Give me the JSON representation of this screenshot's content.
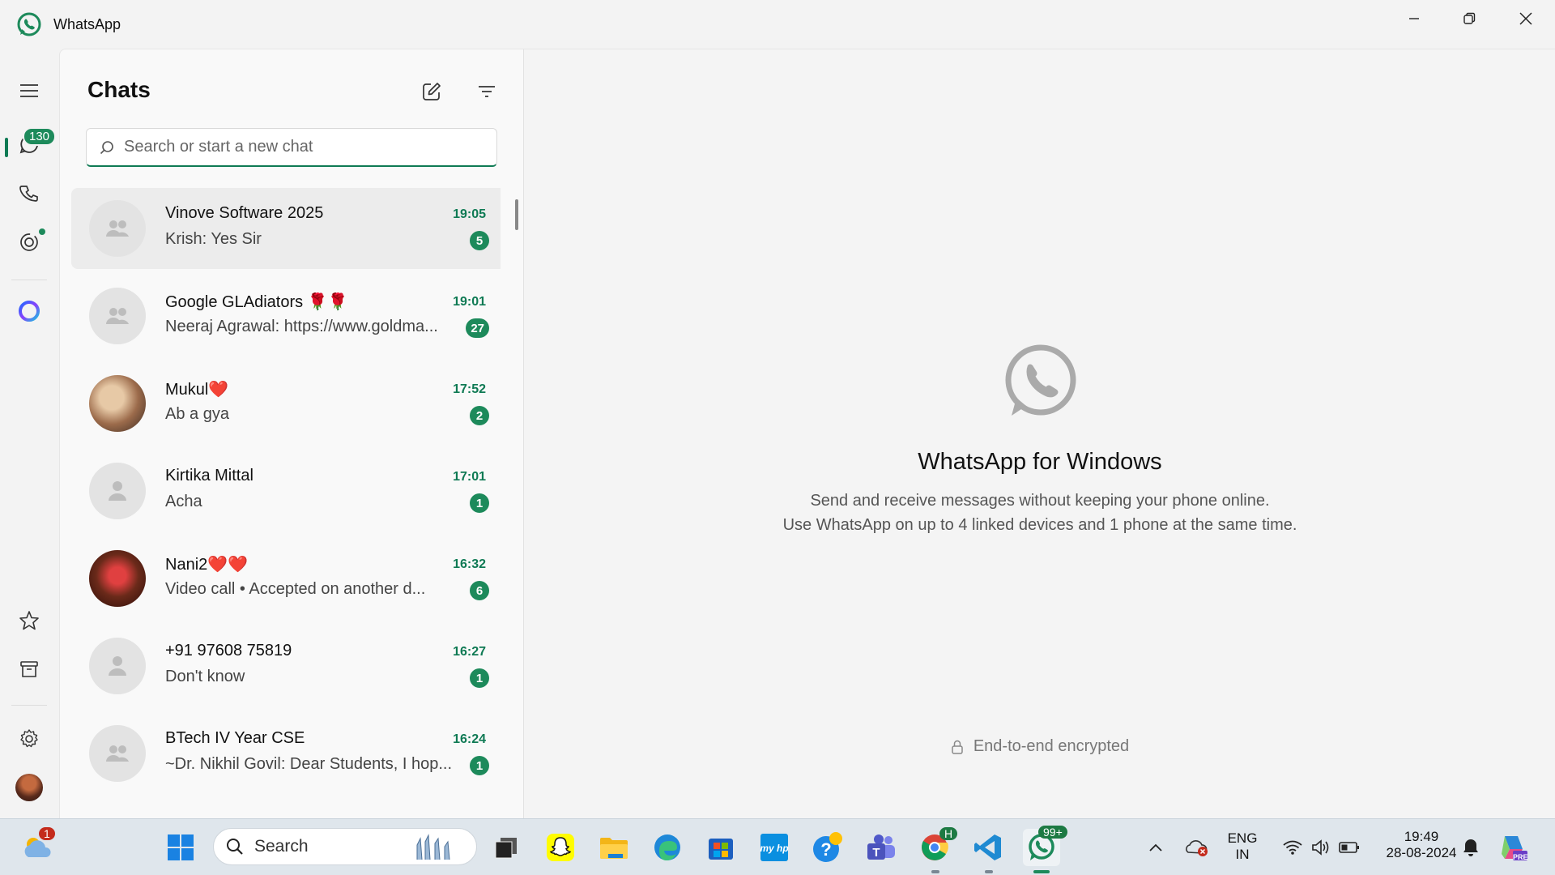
{
  "app": {
    "title": "WhatsApp"
  },
  "rail": {
    "chats_badge": "130"
  },
  "panel": {
    "title": "Chats",
    "search_placeholder": "Search or start a new chat"
  },
  "chats": [
    {
      "name": "Vinove Software 2025",
      "preview": "Krish: Yes Sir",
      "time": "19:05",
      "unread": "5",
      "avatar": "group",
      "selected": true
    },
    {
      "name": "Google GLAdiators 🌹🌹",
      "preview": "Neeraj Agrawal: https://www.goldma...",
      "time": "19:01",
      "unread": "27",
      "avatar": "group"
    },
    {
      "name": "Mukul❤️",
      "preview": "Ab a gya",
      "time": "17:52",
      "unread": "2",
      "avatar": "photo"
    },
    {
      "name": "Kirtika Mittal",
      "preview": "Acha",
      "time": "17:01",
      "unread": "1",
      "avatar": "person"
    },
    {
      "name": "Nani2❤️❤️",
      "preview": "Video call • Accepted on another d...",
      "time": "16:32",
      "unread": "6",
      "avatar": "photo"
    },
    {
      "name": "+91 97608 75819",
      "preview": "Don't know",
      "time": "16:27",
      "unread": "1",
      "avatar": "person"
    },
    {
      "name": "BTech IV Year CSE",
      "preview": "~Dr. Nikhil Govil: Dear Students, I hop...",
      "time": "16:24",
      "unread": "1",
      "avatar": "group"
    }
  ],
  "main": {
    "title": "WhatsApp for Windows",
    "line1": "Send and receive messages without keeping your phone online.",
    "line2": "Use WhatsApp on up to 4 linked devices and 1 phone at the same time.",
    "encrypted": "End-to-end encrypted"
  },
  "taskbar": {
    "weather_badge": "1",
    "search_label": "Search",
    "chrome_badge": "H",
    "whatsapp_badge": "99+",
    "lang_top": "ENG",
    "lang_bottom": "IN",
    "time": "19:49",
    "date": "28-08-2024",
    "copilot_badge": "PRE"
  },
  "colors": {
    "accent": "#1d8a5b",
    "accent_dark": "#0f7a54"
  }
}
